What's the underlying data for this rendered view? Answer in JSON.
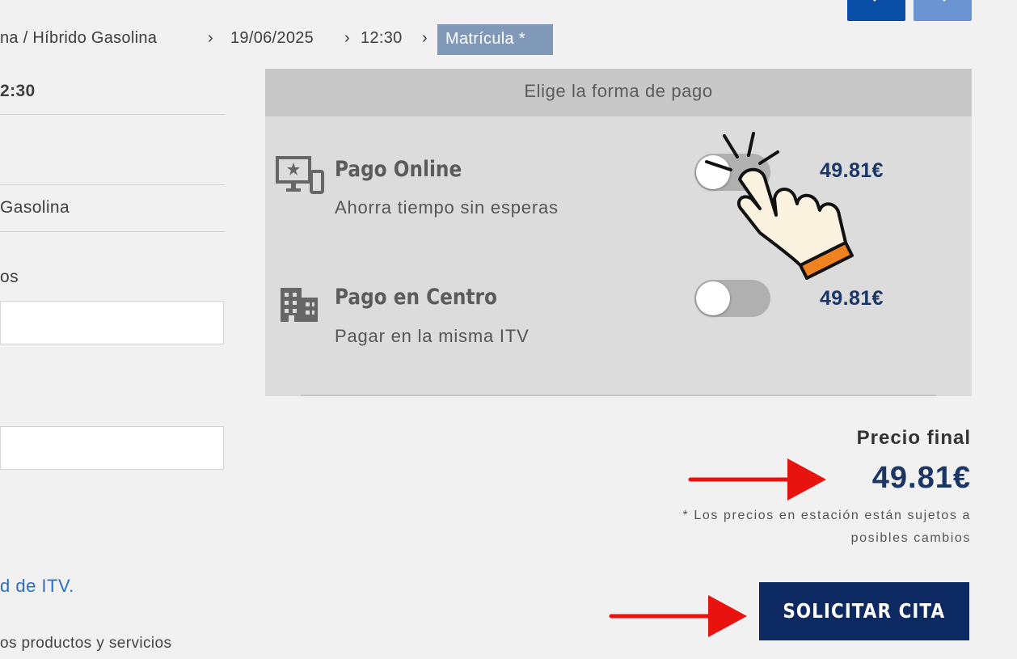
{
  "breadcrumb": {
    "items": [
      "na / Híbrido Gasolina",
      "19/06/2025",
      "12:30"
    ],
    "separator": "›",
    "active": "Matrícula *"
  },
  "left": {
    "time_value": "2:30",
    "fuel_value": "Gasolina",
    "label_os": "os",
    "link_text": "d de ITV.",
    "footer_text": "os productos y servicios"
  },
  "payment": {
    "heading": "Elige la forma de pago",
    "options": [
      {
        "title": "Pago Online",
        "subtitle": "Ahorra tiempo sin esperas",
        "price": "49.81€",
        "selected": false,
        "icon": "monitor-star-icon"
      },
      {
        "title": "Pago en Centro",
        "subtitle": "Pagar en la misma ITV",
        "price": "49.81€",
        "selected": false,
        "icon": "building-icon"
      }
    ]
  },
  "summary": {
    "final_label": "Precio final",
    "final_price": "49.81€",
    "note_line1": "* Los precios en estación están sujetos a",
    "note_line2": "posibles cambios"
  },
  "actions": {
    "submit_label": "SOLICITAR CITA"
  },
  "colors": {
    "background": "#f1f1f1",
    "panel": "#dcdcdc",
    "panel_header": "#c8c8c8",
    "navy": "#0c2a61",
    "price_blue": "#1b3566",
    "breadcrumb_active": "#8199b8",
    "nav_button_primary": "#0a4ea8",
    "nav_button_secondary": "#6b94d3",
    "annotation_arrow": "#e8130f"
  },
  "annotations": {
    "hand_pointer": "pointing-hand-icon",
    "arrows": [
      "arrow-to-final-price",
      "arrow-to-submit-button"
    ]
  }
}
